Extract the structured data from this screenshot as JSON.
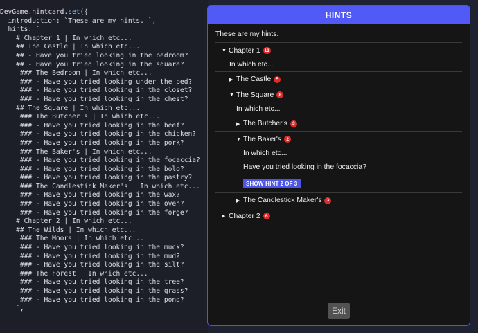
{
  "editor": {
    "lines": [
      [
        {
          "t": "DevGame",
          "c": "obj"
        },
        {
          "t": ".",
          "c": "punc"
        },
        {
          "t": "hintcard",
          "c": "obj"
        },
        {
          "t": ".",
          "c": "punc"
        },
        {
          "t": "set",
          "c": "fn"
        },
        {
          "t": "({",
          "c": "punc"
        }
      ],
      [
        {
          "t": "  introduction: `These are my hints. `,",
          "c": "str"
        }
      ],
      [
        {
          "t": "  hints: `",
          "c": "str"
        }
      ],
      [
        {
          "t": "    # Chapter 1 | In which etc...",
          "c": "str"
        }
      ],
      [
        {
          "t": "    ## The Castle | In which etc...",
          "c": "str"
        }
      ],
      [
        {
          "t": "    ## - Have you tried looking in the bedroom?",
          "c": "str"
        }
      ],
      [
        {
          "t": "    ## - Have you tried looking in the square?",
          "c": "str"
        }
      ],
      [
        {
          "t": "     ### The Bedroom | In which etc...",
          "c": "str"
        }
      ],
      [
        {
          "t": "     ### - Have you tried looking under the bed?",
          "c": "str"
        }
      ],
      [
        {
          "t": "     ### - Have you tried looking in the closet?",
          "c": "str"
        }
      ],
      [
        {
          "t": "     ### - Have you tried looking in the chest?",
          "c": "str"
        }
      ],
      [
        {
          "t": "    ## The Square | In which etc...",
          "c": "str"
        }
      ],
      [
        {
          "t": "     ### The Butcher's | In which etc...",
          "c": "str"
        }
      ],
      [
        {
          "t": "     ### - Have you tried looking in the beef?",
          "c": "str"
        }
      ],
      [
        {
          "t": "     ### - Have you tried looking in the chicken?",
          "c": "str"
        }
      ],
      [
        {
          "t": "     ### - Have you tried looking in the pork?",
          "c": "str"
        }
      ],
      [
        {
          "t": "     ### The Baker's | In which etc...",
          "c": "str"
        }
      ],
      [
        {
          "t": "     ### - Have you tried looking in the focaccia?",
          "c": "str"
        }
      ],
      [
        {
          "t": "     ### - Have you tried looking in the bolo?",
          "c": "str"
        }
      ],
      [
        {
          "t": "     ### - Have you tried looking in the pastry?",
          "c": "str"
        }
      ],
      [
        {
          "t": "     ### The Candlestick Maker's | In which etc...",
          "c": "str"
        }
      ],
      [
        {
          "t": "     ### - Have you tried looking in the wax?",
          "c": "str"
        }
      ],
      [
        {
          "t": "     ### - Have you tried looking in the oven?",
          "c": "str"
        }
      ],
      [
        {
          "t": "     ### - Have you tried looking in the forge?",
          "c": "str"
        }
      ],
      [
        {
          "t": "    # Chapter 2 | In which etc...",
          "c": "str"
        }
      ],
      [
        {
          "t": "    ## The Wilds | In which etc...",
          "c": "str"
        }
      ],
      [
        {
          "t": "     ### The Moors | In which etc...",
          "c": "str"
        }
      ],
      [
        {
          "t": "     ### - Have you tried looking in the muck?",
          "c": "str"
        }
      ],
      [
        {
          "t": "     ### - Have you tried looking in the mud?",
          "c": "str"
        }
      ],
      [
        {
          "t": "     ### - Have you tried looking in the silt?",
          "c": "str"
        }
      ],
      [
        {
          "t": "     ### The Forest | In which etc...",
          "c": "str"
        }
      ],
      [
        {
          "t": "     ### - Have you tried looking in the tree?",
          "c": "str"
        }
      ],
      [
        {
          "t": "     ### - Have you tried looking in the grass?",
          "c": "str"
        }
      ],
      [
        {
          "t": "     ### - Have you tried looking in the pond?",
          "c": "str"
        }
      ],
      [
        {
          "t": "    `,",
          "c": "str"
        }
      ]
    ]
  },
  "modal": {
    "title": "HINTS",
    "intro": "These are my hints.",
    "chapter1": {
      "label": "Chapter 1",
      "badge": "13",
      "desc": "In which etc..."
    },
    "castle": {
      "label": "The Castle",
      "badge": "5"
    },
    "square": {
      "label": "The Square",
      "badge": "8",
      "desc": "In which etc..."
    },
    "butchers": {
      "label": "The Butcher's",
      "badge": "3"
    },
    "bakers": {
      "label": "The Baker's",
      "badge": "2",
      "desc": "In which etc...",
      "hint": "Have you tried looking in the focaccia?",
      "show_hint_prefix": "SHOW HINT",
      "show_hint_current": "2",
      "show_hint_of": "OF",
      "show_hint_total": "3"
    },
    "candlestick": {
      "label": "The Candlestick Maker's",
      "badge": "3"
    },
    "chapter2": {
      "label": "Chapter 2",
      "badge": "6"
    },
    "exit_label": "Exit"
  },
  "colors": {
    "accent": "#5159f6",
    "badge": "#e02a2a",
    "modal_bg": "#151515"
  }
}
